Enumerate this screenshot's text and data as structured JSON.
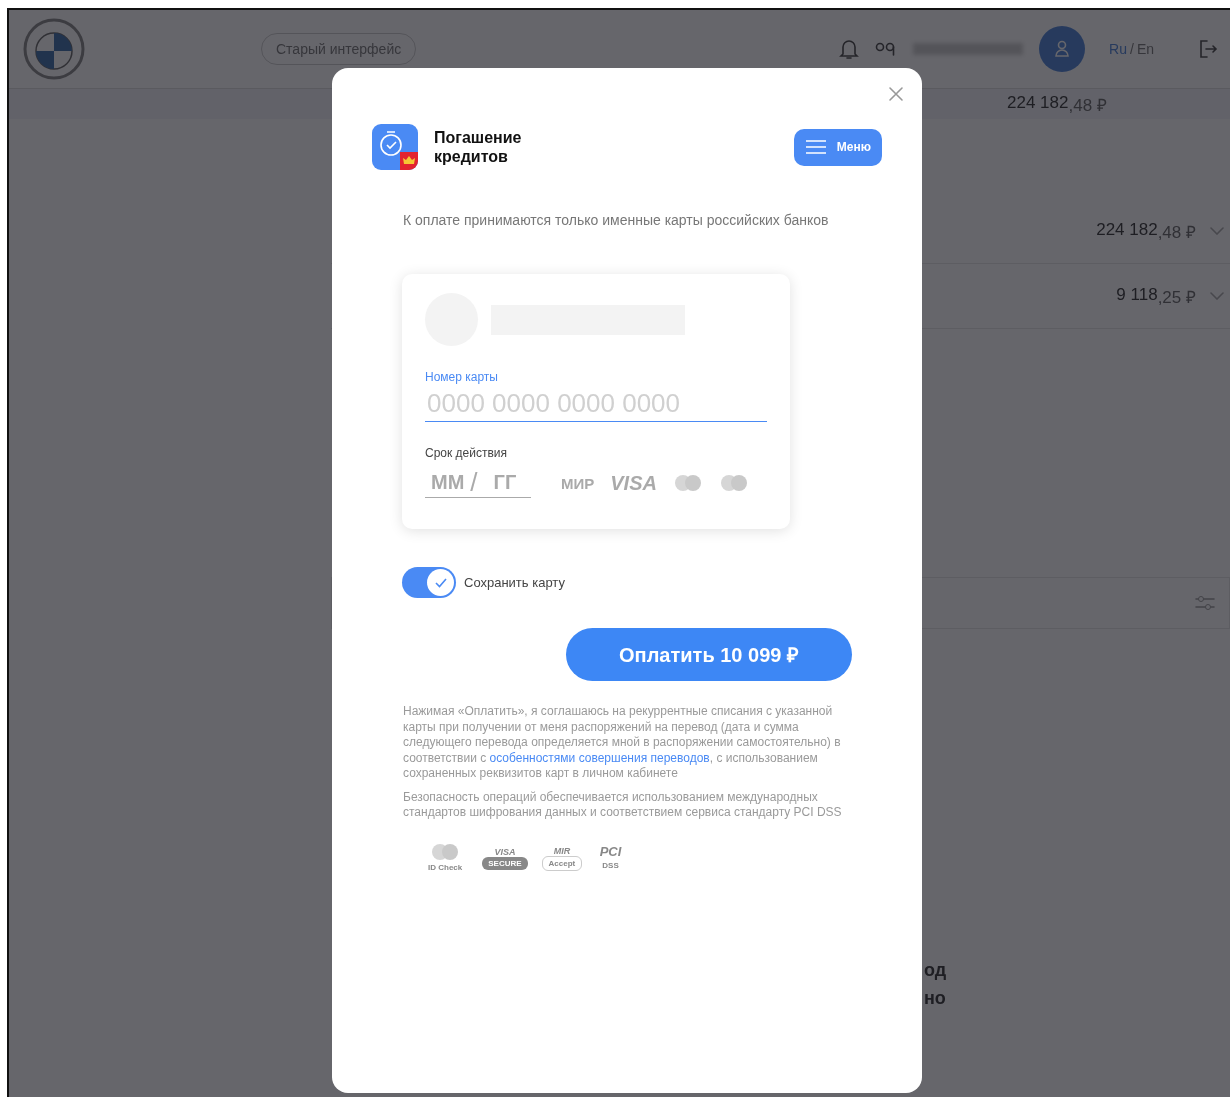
{
  "header": {
    "old_ui_button": "Старый интерфейс",
    "language": {
      "current": "Ru",
      "separator": "/",
      "other": "En"
    }
  },
  "summary": {
    "amount": "224 182",
    "fraction": ",48 ₽"
  },
  "accounts": [
    {
      "amount": "224 182",
      "fraction": ",48 ₽",
      "expanded": false
    },
    {
      "amount": "9 118",
      "fraction": ",25 ₽",
      "expanded": false
    }
  ],
  "cut_texts": [
    "од",
    "но"
  ],
  "modal": {
    "title": "Погашение кредитов",
    "menu_button": "Меню",
    "notice": "К оплате принимаются только именные карты российских банков",
    "card": {
      "number_label": "Номер карты",
      "number_placeholder": "0000 0000 0000 0000",
      "expiry_label": "Срок действия",
      "month_placeholder": "ММ",
      "expiry_separator": "/",
      "year_placeholder": "ГГ",
      "brands": [
        {
          "kind": "mir",
          "text": "МИР"
        },
        {
          "kind": "visa",
          "text": "VISA"
        },
        {
          "kind": "mastercard"
        },
        {
          "kind": "maestro"
        }
      ]
    },
    "save_card": {
      "label": "Сохранить карту",
      "on": true
    },
    "pay_button": "Оплатить 10 099 ₽",
    "consent": {
      "before": "Нажимая «Оплатить», я соглашаюсь на рекуррентные списания с указанной карты при получении от меня распоряжений на перевод (дата и сумма следующего перевода определяется мной в распоряжении самостоятельно) в соответствии с ",
      "link": "особенностями совершения переводов",
      "after": ", с использованием сохраненных реквизитов карт в личном кабинете"
    },
    "security": "Безопасность операций обеспечивается использованием международных стандартов шифрования данных и соответствием сервиса стандарту PCI DSS",
    "badges": [
      {
        "kind": "mastercard",
        "text": "ID Check"
      },
      {
        "kind": "visa",
        "text": "VISA",
        "sub": "SECURE"
      },
      {
        "kind": "mir",
        "text": "MIR",
        "sub": "Accept"
      },
      {
        "kind": "pci",
        "text": "PCI",
        "sub": "DSS"
      }
    ]
  }
}
